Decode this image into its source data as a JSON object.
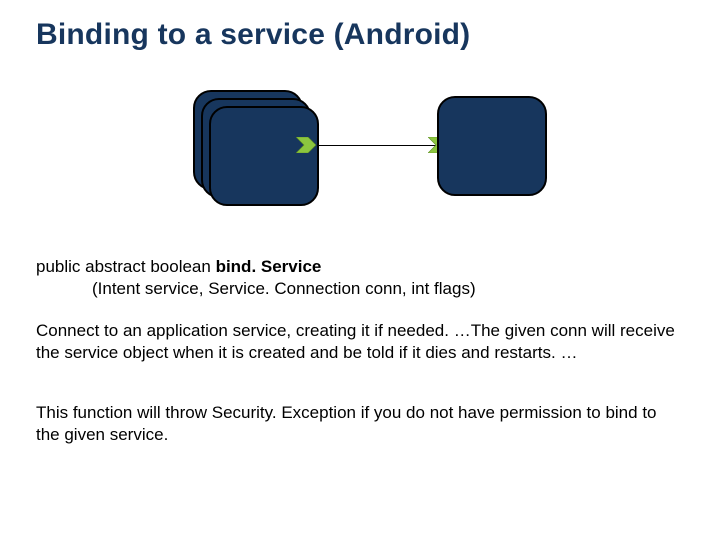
{
  "title": "Binding to a service (Android)",
  "signature": {
    "prefix": "public abstract boolean ",
    "method": "bind. Service",
    "params": "(Intent service, Service. Connection conn, int flags)"
  },
  "paragraph1": "Connect to an application service, creating it if needed. …The given conn will receive the service object when it is created and be told if it dies and restarts. …",
  "paragraph2": "This function will throw Security. Exception if you do not have permission to bind to the given service.",
  "diagram": {
    "left_group": "client-activities-stack",
    "right_box": "service-box",
    "arrow_color": "#8cc63f",
    "box_fill": "#17365d"
  }
}
